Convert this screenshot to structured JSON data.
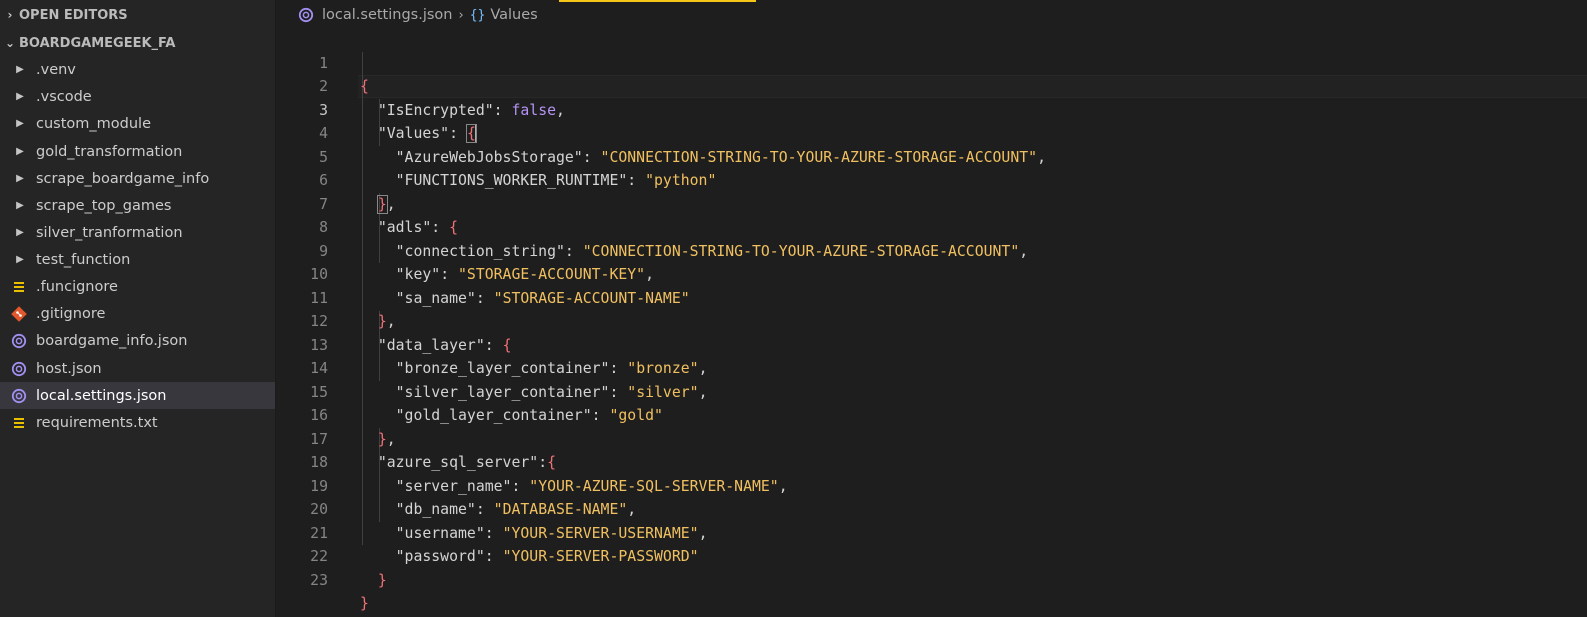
{
  "sidebar": {
    "sections": [
      {
        "label": "OPEN EDITORS",
        "chevron": "›"
      },
      {
        "label": "BOARDGAMEGEEK_FA",
        "chevron": "⌄"
      }
    ],
    "items": [
      {
        "label": ".venv",
        "kind": "folder"
      },
      {
        "label": ".vscode",
        "kind": "folder"
      },
      {
        "label": "custom_module",
        "kind": "folder"
      },
      {
        "label": "gold_transformation",
        "kind": "folder"
      },
      {
        "label": "scrape_boardgame_info",
        "kind": "folder"
      },
      {
        "label": "scrape_top_games",
        "kind": "folder"
      },
      {
        "label": "silver_tranformation",
        "kind": "folder"
      },
      {
        "label": "test_function",
        "kind": "folder"
      },
      {
        "label": ".funcignore",
        "kind": "file",
        "icon": "lines-icon"
      },
      {
        "label": ".gitignore",
        "kind": "file",
        "icon": "git-icon"
      },
      {
        "label": "boardgame_info.json",
        "kind": "file",
        "icon": "json-icon"
      },
      {
        "label": "host.json",
        "kind": "file",
        "icon": "json-icon"
      },
      {
        "label": "local.settings.json",
        "kind": "file",
        "icon": "json-icon",
        "selected": true
      },
      {
        "label": "requirements.txt",
        "kind": "file",
        "icon": "lines-icon"
      }
    ]
  },
  "breadcrumb": {
    "file": "local.settings.json",
    "separator": "›",
    "symbol_icon": "{}",
    "symbol": "Values"
  },
  "editor": {
    "active_line": 3,
    "lines": [
      {
        "n": "1"
      },
      {
        "n": "2"
      },
      {
        "n": "3"
      },
      {
        "n": "4"
      },
      {
        "n": "5"
      },
      {
        "n": "6"
      },
      {
        "n": "7"
      },
      {
        "n": "8"
      },
      {
        "n": "9"
      },
      {
        "n": "10"
      },
      {
        "n": "11"
      },
      {
        "n": "12"
      },
      {
        "n": "13"
      },
      {
        "n": "14"
      },
      {
        "n": "15"
      },
      {
        "n": "16"
      },
      {
        "n": "17"
      },
      {
        "n": "18"
      },
      {
        "n": "19"
      },
      {
        "n": "20"
      },
      {
        "n": "21"
      },
      {
        "n": "22"
      },
      {
        "n": "23"
      }
    ],
    "tokens": {
      "l1": [
        "{"
      ],
      "l2": [
        "\"IsEncrypted\"",
        ": ",
        "false",
        ","
      ],
      "l3": [
        "\"Values\"",
        ": ",
        "{"
      ],
      "l4": [
        "\"AzureWebJobsStorage\"",
        ": ",
        "\"CONNECTION-STRING-TO-YOUR-AZURE-STORAGE-ACCOUNT\"",
        ","
      ],
      "l5": [
        "\"FUNCTIONS_WORKER_RUNTIME\"",
        ": ",
        "\"python\""
      ],
      "l6": [
        "}",
        ","
      ],
      "l7": [
        "\"adls\"",
        ": ",
        "{"
      ],
      "l8": [
        "\"connection_string\"",
        ": ",
        "\"CONNECTION-STRING-TO-YOUR-AZURE-STORAGE-ACCOUNT\"",
        ","
      ],
      "l9": [
        "\"key\"",
        ": ",
        "\"STORAGE-ACCOUNT-KEY\"",
        ","
      ],
      "l10": [
        "\"sa_name\"",
        ": ",
        "\"STORAGE-ACCOUNT-NAME\""
      ],
      "l11": [
        "}",
        ","
      ],
      "l12": [
        "\"data_layer\"",
        ": ",
        "{"
      ],
      "l13": [
        "\"bronze_layer_container\"",
        ": ",
        "\"bronze\"",
        ","
      ],
      "l14": [
        "\"silver_layer_container\"",
        ": ",
        "\"silver\"",
        ","
      ],
      "l15": [
        "\"gold_layer_container\"",
        ": ",
        "\"gold\""
      ],
      "l16": [
        "}",
        ","
      ],
      "l17": [
        "\"azure_sql_server\"",
        ":",
        "{"
      ],
      "l18": [
        "\"server_name\"",
        ": ",
        "\"YOUR-AZURE-SQL-SERVER-NAME\"",
        ","
      ],
      "l19": [
        "\"db_name\"",
        ": ",
        "\"DATABASE-NAME\"",
        ","
      ],
      "l20": [
        "\"username\"",
        ": ",
        "\"YOUR-SERVER-USERNAME\"",
        ","
      ],
      "l21": [
        "\"password\"",
        ": ",
        "\"YOUR-SERVER-PASSWORD\""
      ],
      "l22": [
        "}"
      ],
      "l23": [
        "}"
      ]
    }
  },
  "colors": {
    "string": "#f0c060",
    "boolean": "#b594f5",
    "brace": "#f07178",
    "key": "#d4d4d4",
    "accent": "#f5c518"
  }
}
